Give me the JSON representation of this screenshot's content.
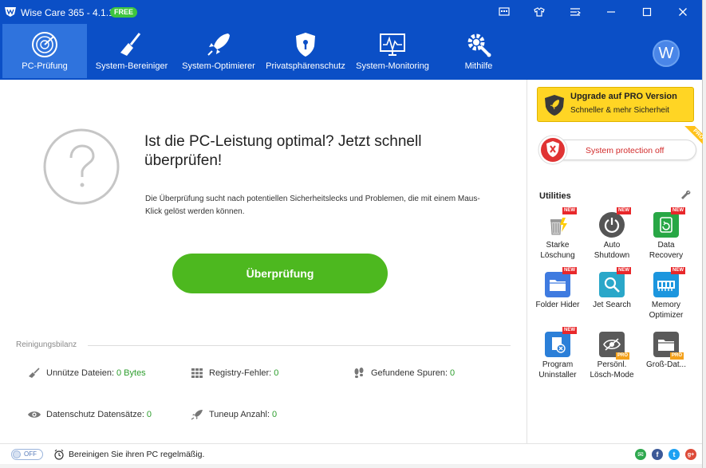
{
  "window": {
    "title": "Wise Care 365 - 4.1.1",
    "badge": "FREE"
  },
  "nav": {
    "items": [
      {
        "label": "PC-Prüfung",
        "icon": "radar-icon"
      },
      {
        "label": "System-Bereiniger",
        "icon": "broom-icon"
      },
      {
        "label": "System-Optimierer",
        "icon": "rocket-icon"
      },
      {
        "label": "Privatsphärenschutz",
        "icon": "shield-icon"
      },
      {
        "label": "System-Monitoring",
        "icon": "monitor-icon"
      },
      {
        "label": "Mithilfe",
        "icon": "gear-wrench-icon"
      }
    ],
    "avatar_letter": "W"
  },
  "main": {
    "headline": "Ist die PC-Leistung optimal?  Jetzt schnell überprüfen!",
    "description": "Die Überprüfung sucht nach potentiellen Sicherheitslecks und Problemen, die mit einem Maus-Klick gelöst werden können.",
    "scan_button": "Überprüfung",
    "summary_title": "Reinigungsbilanz",
    "stats": [
      {
        "label": "Unnütze Dateien:",
        "value": "0 Bytes",
        "icon": "broom-icon"
      },
      {
        "label": "Registry-Fehler:",
        "value": "0",
        "icon": "grid-icon"
      },
      {
        "label": "Gefundene Spuren:",
        "value": "0",
        "icon": "footprints-icon"
      },
      {
        "label": "Datenschutz Datensätze:",
        "value": "0",
        "icon": "eye-icon"
      },
      {
        "label": "Tuneup Anzahl:",
        "value": "0",
        "icon": "rocket-icon"
      }
    ]
  },
  "side": {
    "upgrade_title": "Upgrade auf PRO Version",
    "upgrade_sub": "Schneller & mehr Sicherheit",
    "protection": "System protection off",
    "pro_ribbon": "PRO",
    "utilities_title": "Utilities",
    "utilities": [
      {
        "label1": "Starke",
        "label2": "Löschung",
        "tag": "NEW",
        "icon": "trash-icon"
      },
      {
        "label1": "Auto",
        "label2": "Shutdown",
        "tag": "NEW",
        "icon": "power-icon"
      },
      {
        "label1": "Data",
        "label2": "Recovery",
        "tag": "NEW",
        "icon": "recovery-icon"
      },
      {
        "label1": "Folder Hider",
        "label2": "",
        "tag": "NEW",
        "icon": "folder-icon"
      },
      {
        "label1": "Jet Search",
        "label2": "",
        "tag": "NEW",
        "icon": "search-icon"
      },
      {
        "label1": "Memory",
        "label2": "Optimizer",
        "tag": "NEW",
        "icon": "memory-icon"
      },
      {
        "label1": "Program",
        "label2": "Uninstaller",
        "tag": "NEW",
        "icon": "uninstall-icon"
      },
      {
        "label1": "Persönl.",
        "label2": "Lösch-Mode",
        "tag": "PRO",
        "icon": "privacy-eye-icon"
      },
      {
        "label1": "Groß-Dat...",
        "label2": "",
        "tag": "PRO",
        "icon": "large-file-icon"
      }
    ]
  },
  "status": {
    "toggle": "OFF",
    "text": "Bereinigen Sie ihren PC regelmäßig."
  },
  "colors": {
    "brand_blue": "#0b4fc6",
    "active_tab": "#2f73dd",
    "scan_green": "#4db81f",
    "upgrade_yellow": "#ffd524",
    "alert_red": "#d22b2b"
  }
}
